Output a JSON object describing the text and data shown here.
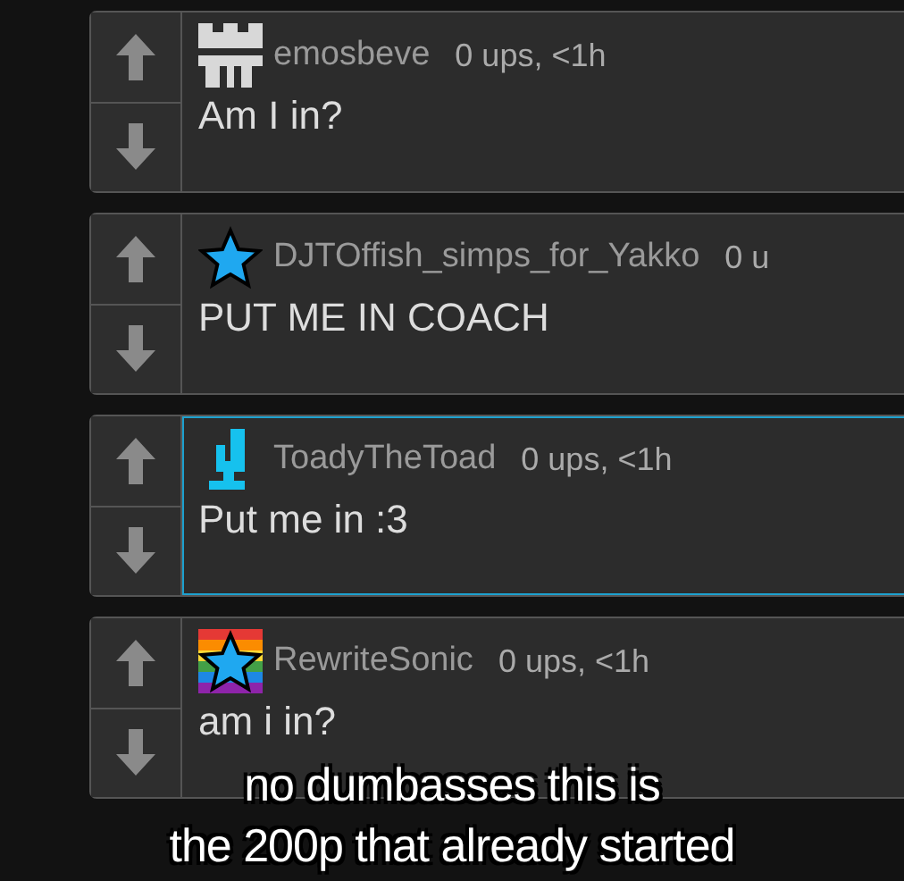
{
  "comments": [
    {
      "kind": "blocks",
      "username": "emosbeve",
      "meta": "0 ups, <1h",
      "text": "Am I in?",
      "highlighted": false
    },
    {
      "kind": "star",
      "username": "DJTOffish_simps_for_Yakko",
      "meta": "0 u",
      "text": "PUT ME IN COACH",
      "highlighted": false
    },
    {
      "kind": "hook",
      "username": "ToadyTheToad",
      "meta": "0 ups, <1h",
      "text": "Put me in :3",
      "highlighted": true
    },
    {
      "kind": "rainbow-star",
      "username": "RewriteSonic",
      "meta": "0 ups, <1h",
      "text": "am i in?",
      "highlighted": false
    }
  ],
  "caption": [
    "no dumbasses this is",
    "the 200p that already started"
  ]
}
